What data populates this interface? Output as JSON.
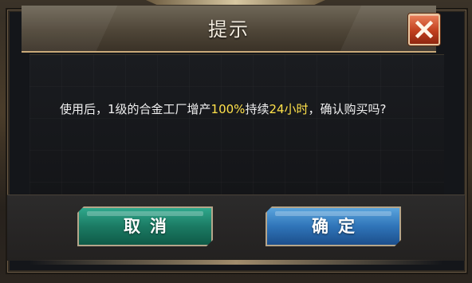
{
  "dialog": {
    "title": "提示",
    "close_icon": "close-x-icon",
    "message": {
      "part1": "使用后，1级的合金工厂增产",
      "highlight1": "100%",
      "part2": "持续",
      "highlight2": "24小时",
      "part3": "，确认购买吗?"
    },
    "highlight_color": "#ffe14a",
    "buttons": {
      "cancel_label": "取消",
      "confirm_label": "确定"
    },
    "colors": {
      "cancel_button": "#1b7a63",
      "confirm_button": "#2f74b8",
      "close_button": "#c1401e"
    }
  }
}
